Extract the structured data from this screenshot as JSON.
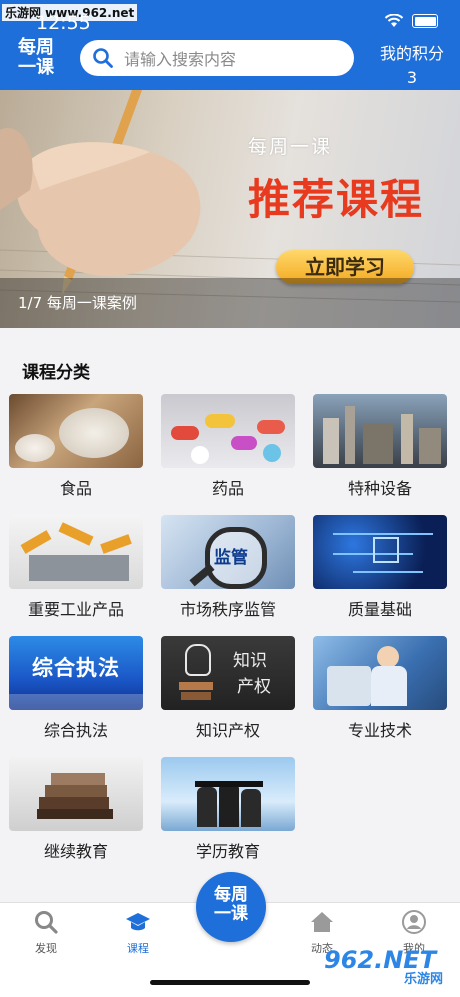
{
  "status": {
    "watermark": "乐游网 www.962.net",
    "time": "12:55"
  },
  "header": {
    "logo_line1": "每周",
    "logo_line2": "一课",
    "search_placeholder": "请输入搜索内容",
    "points_label": "我的积分",
    "points_value": "3"
  },
  "banner": {
    "sub": "每周一课",
    "title": "推荐课程",
    "button": "立即学习",
    "caption": "1/7 每周一课案例"
  },
  "section_title": "课程分类",
  "categories": [
    {
      "label": "食品",
      "icon": "rice-image"
    },
    {
      "label": "药品",
      "icon": "pills-image"
    },
    {
      "label": "特种设备",
      "icon": "industrial-plant-image"
    },
    {
      "label": "重要工业产品",
      "icon": "robot-arms-image"
    },
    {
      "label": "市场秩序监管",
      "icon": "magnifier-image",
      "overlay": "监管"
    },
    {
      "label": "质量基础",
      "icon": "circuit-image"
    },
    {
      "label": "综合执法",
      "icon": "city-image",
      "overlay": "综合执法"
    },
    {
      "label": "知识产权",
      "icon": "chalkboard-image",
      "overlay_a": "知识",
      "overlay_b": "产权"
    },
    {
      "label": "专业技术",
      "icon": "lab-image"
    },
    {
      "label": "继续教育",
      "icon": "books-image"
    },
    {
      "label": "学历教育",
      "icon": "graduates-image"
    }
  ],
  "tabs": [
    {
      "label": "发现",
      "icon": "search-icon"
    },
    {
      "label": "课程",
      "icon": "graduation-cap-icon"
    },
    {
      "label": "动态",
      "icon": "home-icon"
    },
    {
      "label": "我的",
      "icon": "user-icon"
    }
  ],
  "center_line1": "每周",
  "center_line2": "一课",
  "footer_watermark": "962.NET",
  "footer_watermark_sub": "乐游网",
  "colors": {
    "primary": "#1e6fd9",
    "banner_title": "#e83a1f"
  }
}
